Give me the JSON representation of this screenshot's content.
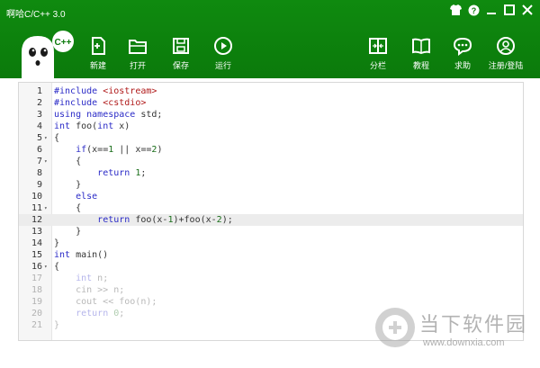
{
  "window": {
    "title": "啊哈C/C++ 3.0"
  },
  "toolbar": {
    "new_label": "新建",
    "open_label": "打开",
    "save_label": "保存",
    "run_label": "运行",
    "split_label": "分栏",
    "tutorial_label": "教程",
    "help_label": "求助",
    "login_label": "注册/登陆"
  },
  "logo": {
    "badge": "C++"
  },
  "editor": {
    "lines": [
      {
        "n": "1",
        "fold": "",
        "code": "#include <iostream>"
      },
      {
        "n": "2",
        "fold": "",
        "code": "#include <cstdio>"
      },
      {
        "n": "3",
        "fold": "",
        "code": "using namespace std;"
      },
      {
        "n": "4",
        "fold": "",
        "code": "int foo(int x)"
      },
      {
        "n": "5",
        "fold": "▾",
        "code": "{"
      },
      {
        "n": "6",
        "fold": "",
        "code": "    if(x==1 || x==2)"
      },
      {
        "n": "7",
        "fold": "▾",
        "code": "    {"
      },
      {
        "n": "8",
        "fold": "",
        "code": "        return 1;"
      },
      {
        "n": "9",
        "fold": "",
        "code": "    }"
      },
      {
        "n": "10",
        "fold": "",
        "code": "    else"
      },
      {
        "n": "11",
        "fold": "▾",
        "code": "    {"
      },
      {
        "n": "12",
        "fold": "",
        "code": "        return foo(x-1)+foo(x-2);"
      },
      {
        "n": "13",
        "fold": "",
        "code": "    }"
      },
      {
        "n": "14",
        "fold": "",
        "code": "}"
      },
      {
        "n": "15",
        "fold": "",
        "code": "int main()"
      },
      {
        "n": "16",
        "fold": "▾",
        "code": "{"
      },
      {
        "n": "17",
        "fold": "",
        "code": "    int n;"
      },
      {
        "n": "18",
        "fold": "",
        "code": "    cin >> n;"
      },
      {
        "n": "19",
        "fold": "",
        "code": "    cout << foo(n);"
      },
      {
        "n": "20",
        "fold": "",
        "code": "    return 0;"
      },
      {
        "n": "21",
        "fold": "",
        "code": "}"
      }
    ],
    "highlighted_line": "12"
  },
  "watermark": {
    "name": "当下软件园",
    "url": "www.downxia.com"
  },
  "colors": {
    "header": "#0b7a0b",
    "keyword": "#2b2bc7",
    "string": "#b01a1a",
    "number": "#1a6e1a"
  },
  "icons": [
    "shirt-icon",
    "help-icon",
    "minimize-icon",
    "maximize-icon",
    "close-icon",
    "new-file-icon",
    "open-folder-icon",
    "save-icon",
    "run-icon",
    "split-icon",
    "book-icon",
    "chat-icon",
    "user-icon"
  ]
}
